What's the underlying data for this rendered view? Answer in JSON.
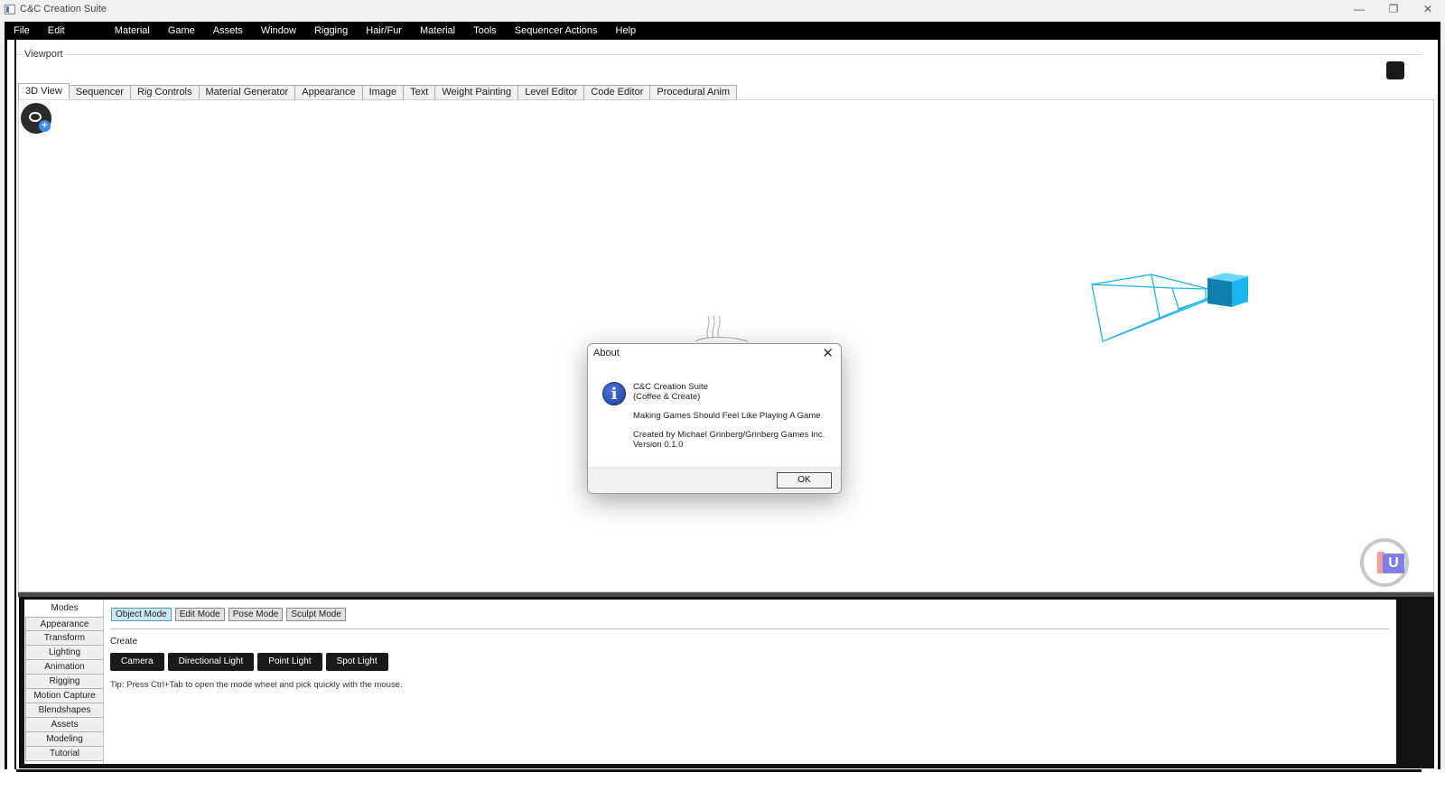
{
  "window": {
    "title": "C&C Creation Suite",
    "controls": {
      "minimize": "—",
      "maximize": "❐",
      "close": "✕"
    }
  },
  "menu": [
    "File",
    "Edit",
    "Material",
    "Game",
    "Assets",
    "Window",
    "Rigging",
    "Hair/Fur",
    "Material",
    "Tools",
    "Sequencer Actions",
    "Help"
  ],
  "viewport": {
    "label": "Viewport",
    "tabs": [
      "3D View",
      "Sequencer",
      "Rig Controls",
      "Material Generator",
      "Appearance",
      "Image",
      "Text",
      "Weight Painting",
      "Level Editor",
      "Code Editor",
      "Procedural Anim"
    ],
    "active_tab": "3D View"
  },
  "gizmo": {
    "label": "U"
  },
  "dialog": {
    "title": "About",
    "close": "✕",
    "icon": "information-icon",
    "app_name": "C&C Creation Suite",
    "subtitle": "(Coffee & Create)",
    "tagline": "Making Games Should Feel Like Playing A Game",
    "credits": "Created by Michael Grinberg/Grinberg Games Inc.",
    "version": "Version 0.1.0",
    "ok_label": "OK"
  },
  "panel": {
    "side_tabs": [
      "Modes",
      "Appearance",
      "Transform",
      "Lighting",
      "Animation",
      "Rigging",
      "Motion Capture",
      "Blendshapes",
      "Assets",
      "Modeling",
      "Tutorial"
    ],
    "active_side_tab": "Modes",
    "modes": [
      "Object Mode",
      "Edit Mode",
      "Pose Mode",
      "Sculpt Mode"
    ],
    "active_mode": "Object Mode",
    "create_label": "Create",
    "create_buttons": [
      "Camera",
      "Directional Light",
      "Point Light",
      "Spot Light"
    ],
    "tip": "Tip: Press Ctrl+Tab to open the mode wheel and pick quickly with the mouse."
  },
  "colors": {
    "menubar": "#000000",
    "camera_gizmo": "#1ab5ec",
    "active_mode": "#cce8f7",
    "create_button": "#1a1a1a"
  }
}
